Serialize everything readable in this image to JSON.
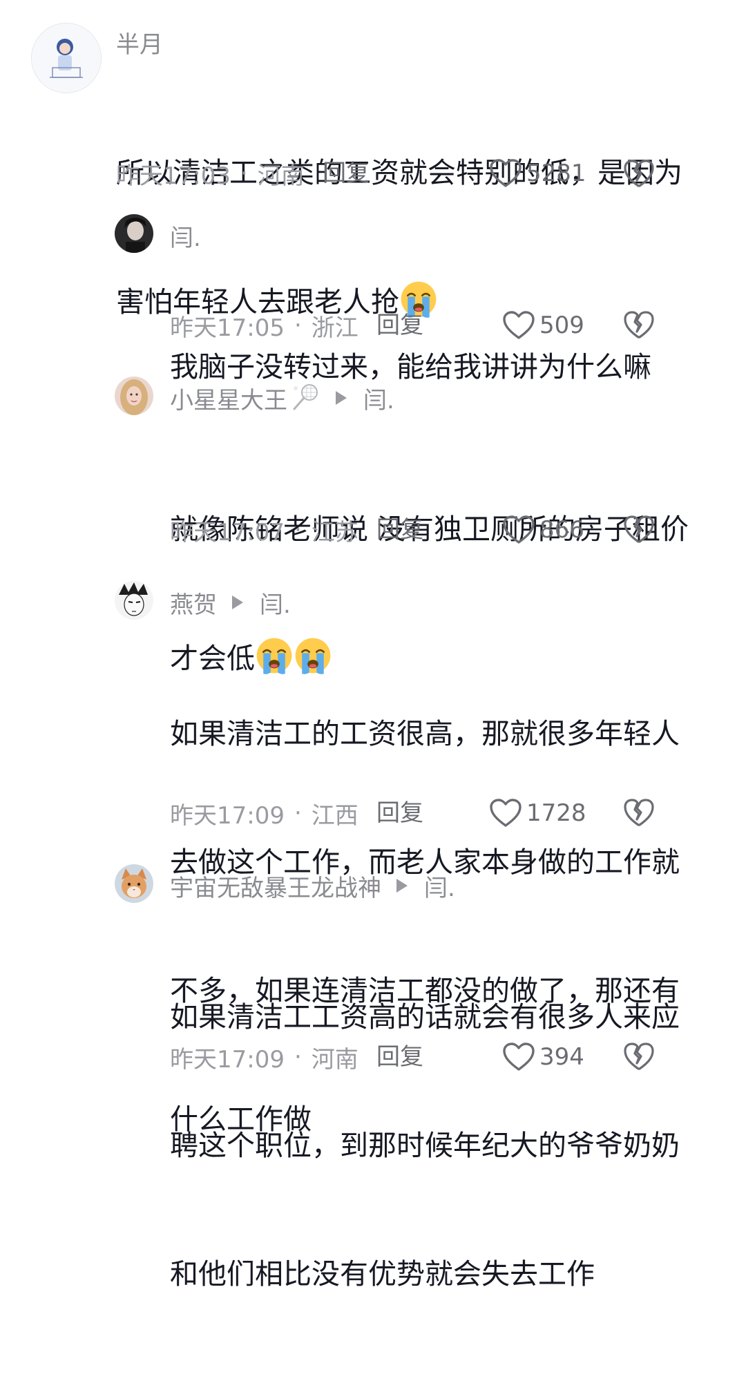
{
  "comments": [
    {
      "author": "半月",
      "lines": [
        "所以清洁工之类的工资就会特别的低，是因为",
        "害怕年轻人去跟老人抢"
      ],
      "emojis_after_last_line": 1,
      "time": "昨天17:03",
      "location": "河南",
      "reply_label": "回复",
      "likes": "5281",
      "avatar_icon": "girl-drawing-avatar"
    },
    {
      "author": "闫.",
      "lines": [
        "我脑子没转过来，能给我讲讲为什么嘛"
      ],
      "emojis_after_last_line": 0,
      "time": "昨天17:05",
      "location": "浙江",
      "reply_label": "回复",
      "likes": "509",
      "avatar_icon": "dark-photo-avatar"
    },
    {
      "author": "小星星大王",
      "author_emoji": "badminton-icon",
      "reply_to": "闫.",
      "lines": [
        "就像陈铭老师说 没有独卫厕所的房子租价",
        "才会低"
      ],
      "emojis_after_last_line": 2,
      "time": "昨天17:07",
      "location": "江苏",
      "reply_label": "回复",
      "likes": "866",
      "avatar_icon": "blonde-girl-avatar"
    },
    {
      "author": "燕贺",
      "reply_to": "闫.",
      "lines": [
        "如果清洁工的工资很高，那就很多年轻人",
        "去做这个工作，而老人家本身做的工作就",
        "不多，如果连清洁工都没的做了，那还有",
        "什么工作做"
      ],
      "emojis_after_last_line": 0,
      "time": "昨天17:09",
      "location": "江西",
      "reply_label": "回复",
      "likes": "1728",
      "avatar_icon": "manga-avatar"
    },
    {
      "author": "宇宙无敌暴王龙战神",
      "reply_to": "闫.",
      "lines": [
        "如果清洁工工资高的话就会有很多人来应",
        "聘这个职位，到那时候年纪大的爷爷奶奶",
        "和他们相比没有优势就会失去工作"
      ],
      "emojis_after_last_line": 0,
      "time": "昨天17:09",
      "location": "河南",
      "reply_label": "回复",
      "likes": "394",
      "avatar_icon": "cat-avatar"
    }
  ],
  "separator": "·",
  "emoji_icon": "loudly-crying-face-icon",
  "like_icon": "heart-outline-icon",
  "dislike_icon": "broken-heart-icon",
  "reply_arrow_icon": "triangle-right-icon"
}
